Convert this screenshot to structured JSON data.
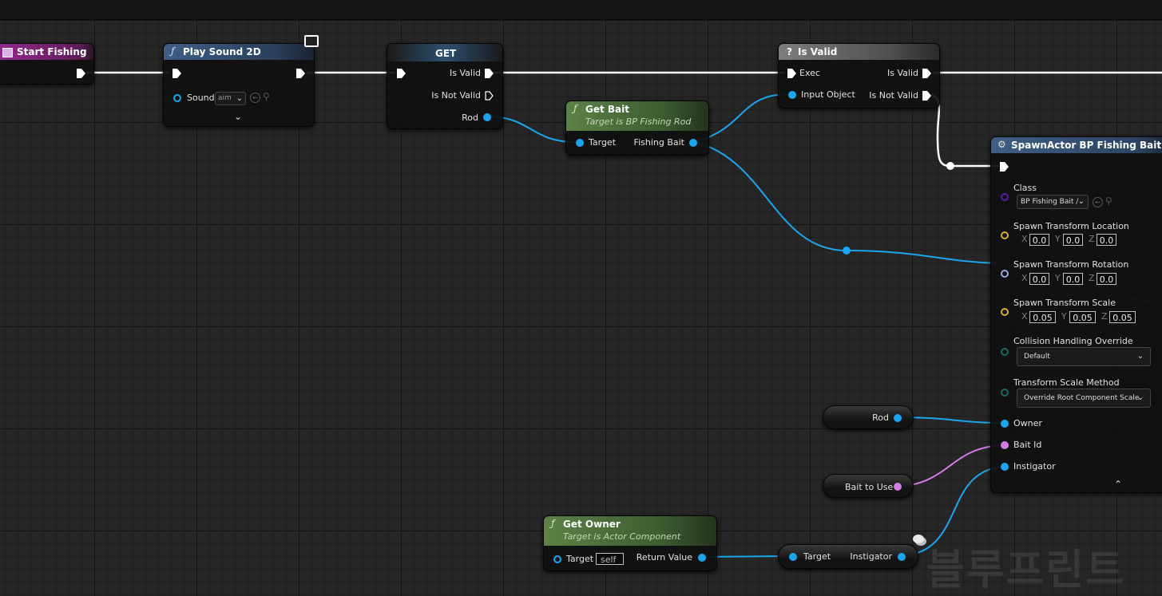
{
  "nodes": {
    "start_fishing": {
      "title": "Start Fishing"
    },
    "play_sound": {
      "title": "Play Sound 2D",
      "sound_label": "Sound",
      "sound_value": "aim"
    },
    "get": {
      "title": "GET",
      "is_valid": "Is Valid",
      "is_not_valid": "Is Not Valid",
      "rod": "Rod"
    },
    "get_bait": {
      "title": "Get Bait",
      "subtitle": "Target is BP Fishing Rod",
      "target": "Target",
      "fishing_bait": "Fishing Bait"
    },
    "is_valid": {
      "title": "Is Valid",
      "exec": "Exec",
      "input_object": "Input Object",
      "is_valid": "Is Valid",
      "is_not_valid": "Is Not Valid"
    },
    "spawn_actor": {
      "title": "SpawnActor BP Fishing Bait Asset",
      "class_label": "Class",
      "class_value": "BP Fishing Bait /",
      "location_label": "Spawn Transform Location",
      "location": {
        "x": "0.0",
        "y": "0.0",
        "z": "0.0"
      },
      "rotation_label": "Spawn Transform Rotation",
      "rotation": {
        "x": "0.0",
        "y": "0.0",
        "z": "0.0"
      },
      "scale_label": "Spawn Transform Scale",
      "scale": {
        "x": "0.05",
        "y": "0.05",
        "z": "0.05"
      },
      "collision_label": "Collision Handling Override",
      "collision_value": "Default",
      "transform_method_label": "Transform Scale Method",
      "transform_method_value": "Override Root Component Scale",
      "owner": "Owner",
      "bait_id": "Bait Id",
      "instigator": "Instigator"
    },
    "rod_var": {
      "label": "Rod"
    },
    "bait_to_use": {
      "label": "Bait to Use"
    },
    "get_owner": {
      "title": "Get Owner",
      "subtitle": "Target is Actor Component",
      "target": "Target",
      "target_value": "self",
      "return_value": "Return Value"
    },
    "instigator_node": {
      "target": "Target",
      "instigator": "Instigator"
    }
  },
  "axis_labels": {
    "x": "X",
    "y": "Y",
    "z": "Z"
  },
  "watermark": "블루프린트",
  "colors": {
    "event_header": "#8e2a86",
    "function_header": "#3d5a80",
    "pure_header": "#4f6b3c",
    "exec_wire": "#ffffff",
    "object_wire": "#1aa6ef",
    "name_wire": "#d27ce8"
  }
}
